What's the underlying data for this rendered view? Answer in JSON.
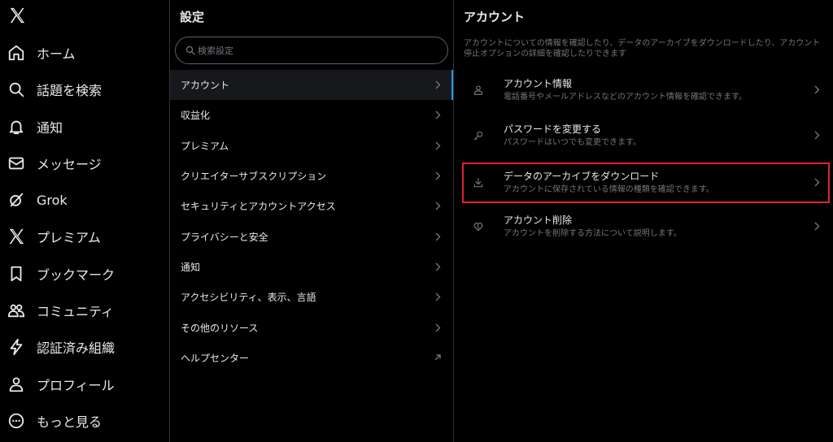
{
  "nav": {
    "logo_icon": "x-logo-icon",
    "items": [
      {
        "label": "ホーム",
        "icon": "home-icon"
      },
      {
        "label": "話題を検索",
        "icon": "search-icon"
      },
      {
        "label": "通知",
        "icon": "bell-icon"
      },
      {
        "label": "メッセージ",
        "icon": "envelope-icon"
      },
      {
        "label": "Grok",
        "icon": "grok-icon"
      },
      {
        "label": "プレミアム",
        "icon": "x-logo-icon"
      },
      {
        "label": "ブックマーク",
        "icon": "bookmark-icon"
      },
      {
        "label": "コミュニティ",
        "icon": "people-icon"
      },
      {
        "label": "認証済み組織",
        "icon": "bolt-icon"
      },
      {
        "label": "プロフィール",
        "icon": "person-icon"
      },
      {
        "label": "もっと見る",
        "icon": "more-circle-icon"
      }
    ]
  },
  "settings": {
    "title": "設定",
    "search_placeholder": "検索設定",
    "items": [
      {
        "label": "アカウント",
        "active": true,
        "icon": "chevron-right-icon"
      },
      {
        "label": "収益化",
        "icon": "chevron-right-icon"
      },
      {
        "label": "プレミアム",
        "icon": "chevron-right-icon"
      },
      {
        "label": "クリエイターサブスクリプション",
        "icon": "chevron-right-icon"
      },
      {
        "label": "セキュリティとアカウントアクセス",
        "icon": "chevron-right-icon"
      },
      {
        "label": "プライバシーと安全",
        "icon": "chevron-right-icon"
      },
      {
        "label": "通知",
        "icon": "chevron-right-icon"
      },
      {
        "label": "アクセシビリティ、表示、言語",
        "icon": "chevron-right-icon"
      },
      {
        "label": "その他のリソース",
        "icon": "chevron-right-icon"
      },
      {
        "label": "ヘルプセンター",
        "icon": "external-arrow-icon"
      }
    ]
  },
  "account": {
    "title": "アカウント",
    "description": "アカウントについての情報を確認したり、データのアーカイブをダウンロードしたり、アカウント停止オプションの詳細を確認したりできます",
    "items": [
      {
        "title": "アカウント情報",
        "subtitle": "電話番号やメールアドレスなどのアカウント情報を確認できます。",
        "icon": "person-icon"
      },
      {
        "title": "パスワードを変更する",
        "subtitle": "パスワードはいつでも変更できます。",
        "icon": "key-icon"
      },
      {
        "title": "データのアーカイブをダウンロード",
        "subtitle": "アカウントに保存されている情報の種類を確認できます。",
        "icon": "download-icon",
        "highlighted": true
      },
      {
        "title": "アカウント削除",
        "subtitle": "アカウントを削除する方法について説明します。",
        "icon": "broken-heart-icon"
      }
    ]
  },
  "colors": {
    "background": "#000000",
    "text": "#e7e9ea",
    "muted": "#71767b",
    "accent": "#1d9bf0",
    "highlight_border": "#e0242a"
  }
}
